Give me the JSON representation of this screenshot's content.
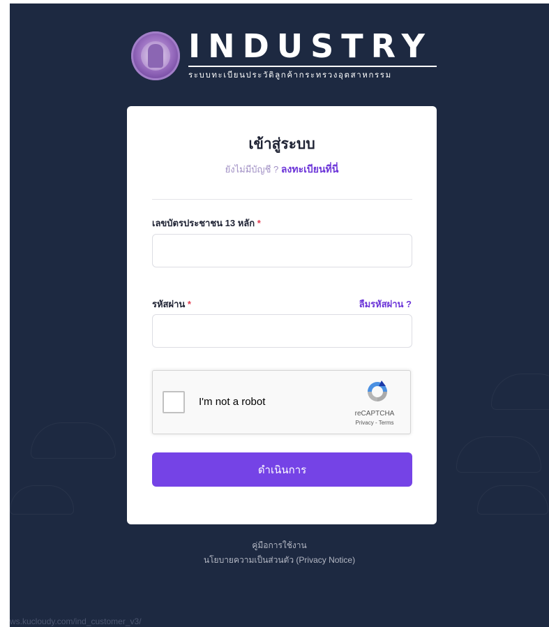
{
  "brand": {
    "name": "INDUSTRY",
    "subtitle": "ระบบทะเบียนประวัติลูกค้ากระทรวงอุตสาหกรรม"
  },
  "login": {
    "title": "เข้าสู่ระบบ",
    "no_account_text": "ยังไม่มีบัญชี ?",
    "register_link": "ลงทะเบียนที่นี่",
    "id_label": "เลขบัตรประชาชน 13 หลัก",
    "id_value": "",
    "password_label": "รหัสผ่าน",
    "password_value": "",
    "required_mark": "*",
    "forgot_link": "ลืมรหัสผ่าน ?",
    "submit_label": "ดำเนินการ"
  },
  "recaptcha": {
    "checkbox_label": "I'm not a robot",
    "brand": "reCAPTCHA",
    "links": "Privacy - Terms",
    "checked": false
  },
  "footer": {
    "manual_link": "คู่มือการใช้งาน",
    "privacy_link": "นโยบายความเป็นส่วนตัว (Privacy Notice)"
  },
  "status_bar": {
    "url": "ws.kucloudy.com/ind_customer_v3/"
  },
  "colors": {
    "background": "#1d2941",
    "accent": "#7543e6",
    "link": "#6c35d8",
    "required": "#e23a4f"
  }
}
